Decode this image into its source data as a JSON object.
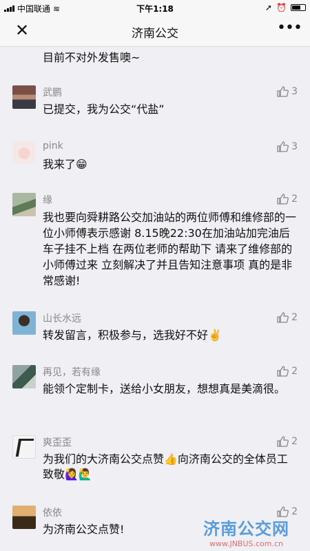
{
  "status": {
    "carrier": "中国联通",
    "time": "下午1:18"
  },
  "nav": {
    "title": "济南公交"
  },
  "partial_text": "目前不对外发售噢~",
  "comments": [
    {
      "name": "武鹏",
      "likes": "3",
      "text": "已提交，我为公交“代盐”"
    },
    {
      "name": "pink",
      "likes": "3",
      "text": "我来了😁"
    },
    {
      "name": "缘",
      "likes": "2",
      "text": "我也要向舜耕路公交加油站的两位师傅和维修部的一位小师傅表示感谢 8.15晚22:30在加油站加完油后 车子挂不上档 在两位老师的帮助下 请来了维修部的小师傅过来 立刻解决了并且告知注意事项 真的是非常感谢!"
    },
    {
      "name": "山长水远",
      "likes": "2",
      "text": "转发留言，积极参与，选我好不好✌️"
    },
    {
      "name": "再见，若有缘",
      "likes": "2",
      "text": "能领个定制卡，送给小女朋友，想想真是美滴很。"
    },
    {
      "name": "爽歪歪",
      "likes": "2",
      "text": "为我们的大济南公交点赞👍向济南公交的全体员工致敬🙋‍♀️🙋‍♂️"
    },
    {
      "name": "依依",
      "likes": "2",
      "text": "为济南公交点赞!"
    }
  ],
  "watermark": {
    "title": "济南公交网",
    "url": "www.JNBUS.com.cn"
  }
}
